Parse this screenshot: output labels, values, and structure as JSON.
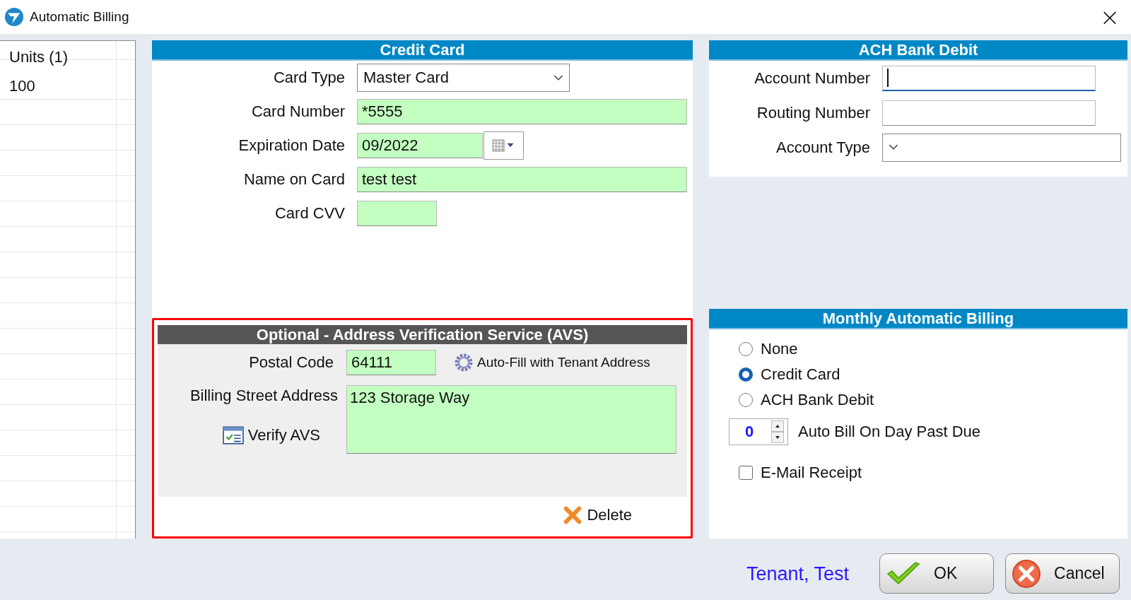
{
  "window": {
    "title": "Automatic Billing",
    "close": "×"
  },
  "units_list": {
    "header": "Units (1)",
    "rows": [
      "100"
    ]
  },
  "credit_card": {
    "title": "Credit Card",
    "fields": [
      {
        "label": "Card Type",
        "kind": "dropdown",
        "value": "Master Card",
        "highlighted": false
      },
      {
        "label": "Card Number",
        "kind": "text",
        "value": "*5555",
        "highlighted": true
      },
      {
        "label": "Expiration Date",
        "kind": "date",
        "value": "09/2022",
        "highlighted": true
      },
      {
        "label": "Name on Card",
        "kind": "text",
        "value": "test test",
        "highlighted": true
      },
      {
        "label": "Card CVV",
        "kind": "short",
        "highlighted": true
      }
    ]
  },
  "avs": {
    "title": "Optional - Address Verification Service (AVS)",
    "postal_label": "Postal Code",
    "postal_value": "64111",
    "autofill_button": "Auto-Fill with Tenant Address",
    "street_label": "Billing Street Address",
    "street_value": "123 Storage Way",
    "verify_button": "Verify AVS",
    "delete_button": "Delete"
  },
  "ach": {
    "title": "ACH Bank Debit",
    "fields": [
      {
        "label": "Account Number",
        "kind": "text",
        "focused": true
      },
      {
        "label": "Routing Number",
        "kind": "text",
        "focused": false
      },
      {
        "label": "Account Type",
        "kind": "dropdown",
        "focused": false
      }
    ]
  },
  "monthly": {
    "title": "Monthly Automatic Billing",
    "options": [
      {
        "label": "None",
        "selected": false
      },
      {
        "label": "Credit Card",
        "selected": true
      },
      {
        "label": "ACH Bank Debit",
        "selected": false
      }
    ],
    "day_value": "0",
    "day_label": "Auto Bill On Day Past Due",
    "email_receipt": {
      "label": "E-Mail Receipt",
      "checked": false
    }
  },
  "footer": {
    "tenant_name": "Tenant, Test",
    "buttons": [
      {
        "label": "OK",
        "kind": "ok"
      },
      {
        "label": "Cancel",
        "kind": "cancel"
      }
    ]
  }
}
